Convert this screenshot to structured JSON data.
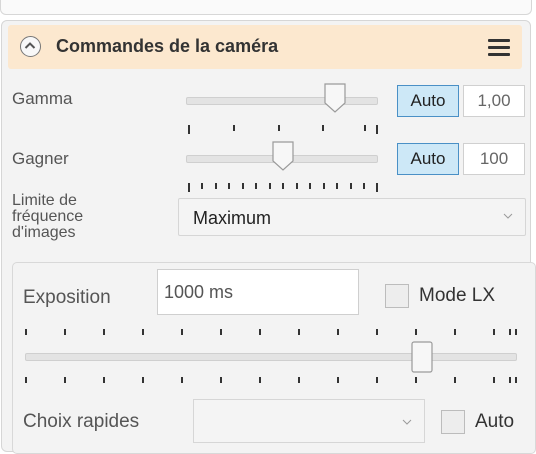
{
  "header": {
    "title": "Commandes de la caméra"
  },
  "gamma": {
    "label": "Gamma",
    "auto_label": "Auto",
    "value": "1,00",
    "slider_level": 0.78
  },
  "gain": {
    "label": "Gagner",
    "auto_label": "Auto",
    "value": "100",
    "slider_level": 0.52
  },
  "frame_rate": {
    "label": "Limite de fréquence d'images",
    "selected": "Maximum"
  },
  "exposure": {
    "label": "Exposition",
    "value": "1000 ms",
    "mode_lx_label": "Mode LX",
    "slider_level": 0.82
  },
  "quick_choices": {
    "label": "Choix rapides",
    "selected": "",
    "auto_label": "Auto"
  },
  "icons": {
    "collapse": "chevron-up-icon",
    "menu": "hamburger-menu-icon",
    "dropdown": "chevron-down-icon"
  },
  "colors": {
    "header_bg": "#fce8cf",
    "auto_active_bg": "#cde8f7",
    "auto_active_border": "#4a90c6"
  }
}
